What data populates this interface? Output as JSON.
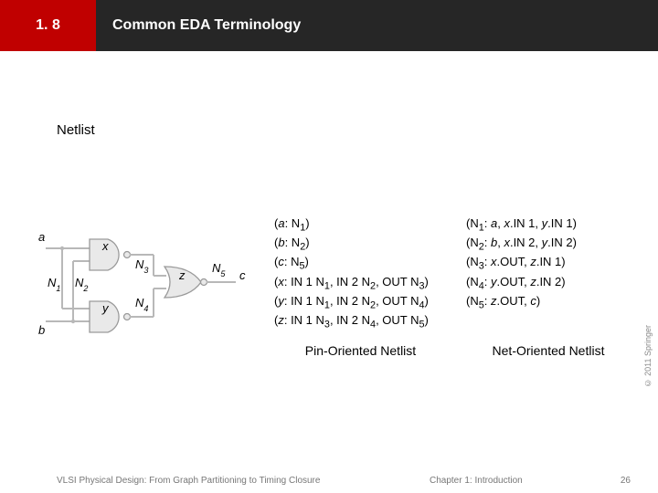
{
  "header": {
    "section_number": "1. 8",
    "title": "Common EDA Terminology"
  },
  "labels": {
    "netlist": "Netlist",
    "a": "a",
    "b": "b",
    "c": "c",
    "x": "x",
    "y": "y",
    "z": "z",
    "N1": "N",
    "N2": "N",
    "N3": "N",
    "N4": "N",
    "N5": "N",
    "s1": "1",
    "s2": "2",
    "s3": "3",
    "s4": "4",
    "s5": "5"
  },
  "pin_netlist": {
    "caption": "Pin-Oriented Netlist",
    "rows": [
      {
        "pre": "(",
        "k": "a",
        "post": ": N",
        "sub": "1",
        "tail": ")"
      },
      {
        "pre": "(",
        "k": "b",
        "post": ": N",
        "sub": "2",
        "tail": ")"
      },
      {
        "pre": "(",
        "k": "c",
        "post": ": N",
        "sub": "5",
        "tail": ")"
      },
      {
        "pre": "(",
        "k": "x",
        "post": ": IN 1 N",
        "sub": "1",
        "mid": ", IN 2 N",
        "sub2": "2",
        "mid2": ", OUT N",
        "sub3": "3",
        "tail2": ")"
      },
      {
        "pre": "(",
        "k": "y",
        "post": ": IN 1 N",
        "sub": "1",
        "mid": ", IN 2 N",
        "sub2": "2",
        "mid2": ", OUT N",
        "sub3": "4",
        "tail2": ")"
      },
      {
        "pre": "(",
        "k": "z",
        "post": ": IN 1 N",
        "sub": "3",
        "mid": ", IN 2 N",
        "sub2": "4",
        "mid2": ", OUT N",
        "sub3": "5",
        "tail2": ")"
      }
    ]
  },
  "net_netlist": {
    "caption": "Net-Oriented Netlist",
    "rows": [
      {
        "pre": "(N",
        "ksub": "1",
        "post": ": ",
        "it1": "a",
        "mid": ", ",
        "it2": "x",
        "tail1": ".IN 1, ",
        "it3": "y",
        "tail2": ".IN 1)"
      },
      {
        "pre": "(N",
        "ksub": "2",
        "post": ": ",
        "it1": "b",
        "mid": ", ",
        "it2": "x",
        "tail1": ".IN 2, ",
        "it3": "y",
        "tail2": ".IN 2)"
      },
      {
        "pre": "(N",
        "ksub": "3",
        "post": ": ",
        "it1": "x",
        "mid": ".OUT, ",
        "it2": "z",
        "tail1": ".IN 1)",
        "it3": "",
        "tail2": ""
      },
      {
        "pre": "(N",
        "ksub": "4",
        "post": ": ",
        "it1": "y",
        "mid": ".OUT, ",
        "it2": "z",
        "tail1": ".IN 2)",
        "it3": "",
        "tail2": ""
      },
      {
        "pre": "(N",
        "ksub": "5",
        "post": ": ",
        "it1": "z",
        "mid": ".OUT, ",
        "it2": "c",
        "tail1": ")",
        "it3": "",
        "tail2": ""
      }
    ]
  },
  "footer": {
    "left": "VLSI Physical Design: From Graph Partitioning to Timing Closure",
    "mid": "Chapter 1: Introduction",
    "page": "26",
    "copyright": "© 2011 Springer"
  }
}
